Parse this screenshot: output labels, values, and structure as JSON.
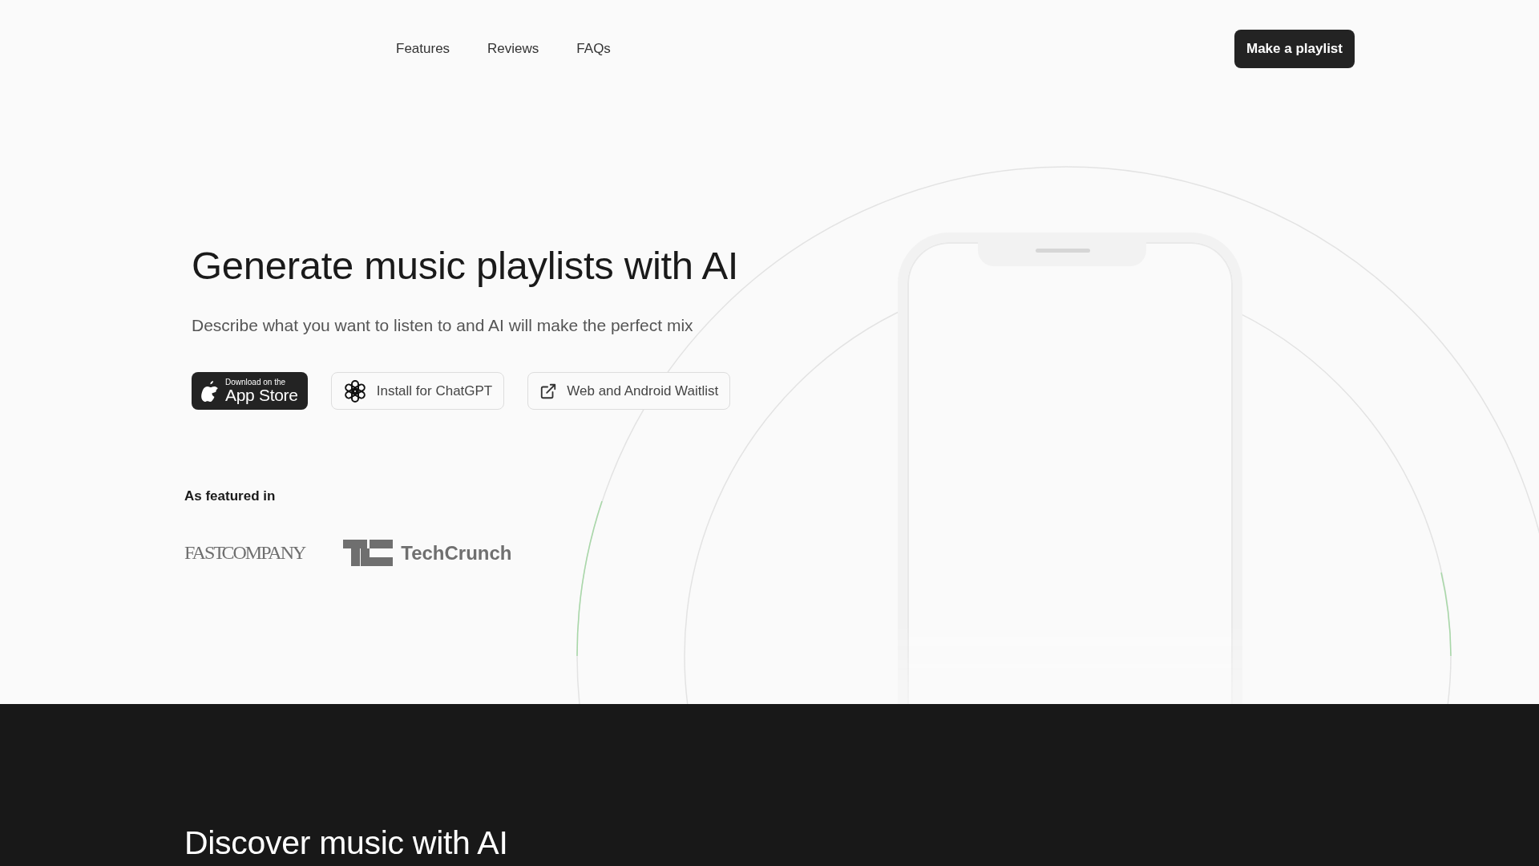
{
  "nav": {
    "links": [
      {
        "label": "Features"
      },
      {
        "label": "Reviews"
      },
      {
        "label": "FAQs"
      }
    ],
    "cta": "Make a playlist"
  },
  "hero": {
    "title": "Generate music playlists with AI",
    "subtitle": "Describe what you want to listen to and AI will make the perfect mix",
    "buttons": [
      {
        "kind": "appstore",
        "caption": "Download on the",
        "label": "App Store"
      },
      {
        "kind": "chatgpt",
        "label": "Install for ChatGPT"
      },
      {
        "kind": "external",
        "label": "Web and Android Waitlist"
      }
    ]
  },
  "featured": {
    "heading": "As featured in",
    "logos": [
      {
        "kind": "fastcompany",
        "text": "FAST COMPANY"
      },
      {
        "kind": "techcrunch",
        "text": "TechCrunch"
      }
    ]
  },
  "discover": {
    "title": "Discover music with AI"
  }
}
